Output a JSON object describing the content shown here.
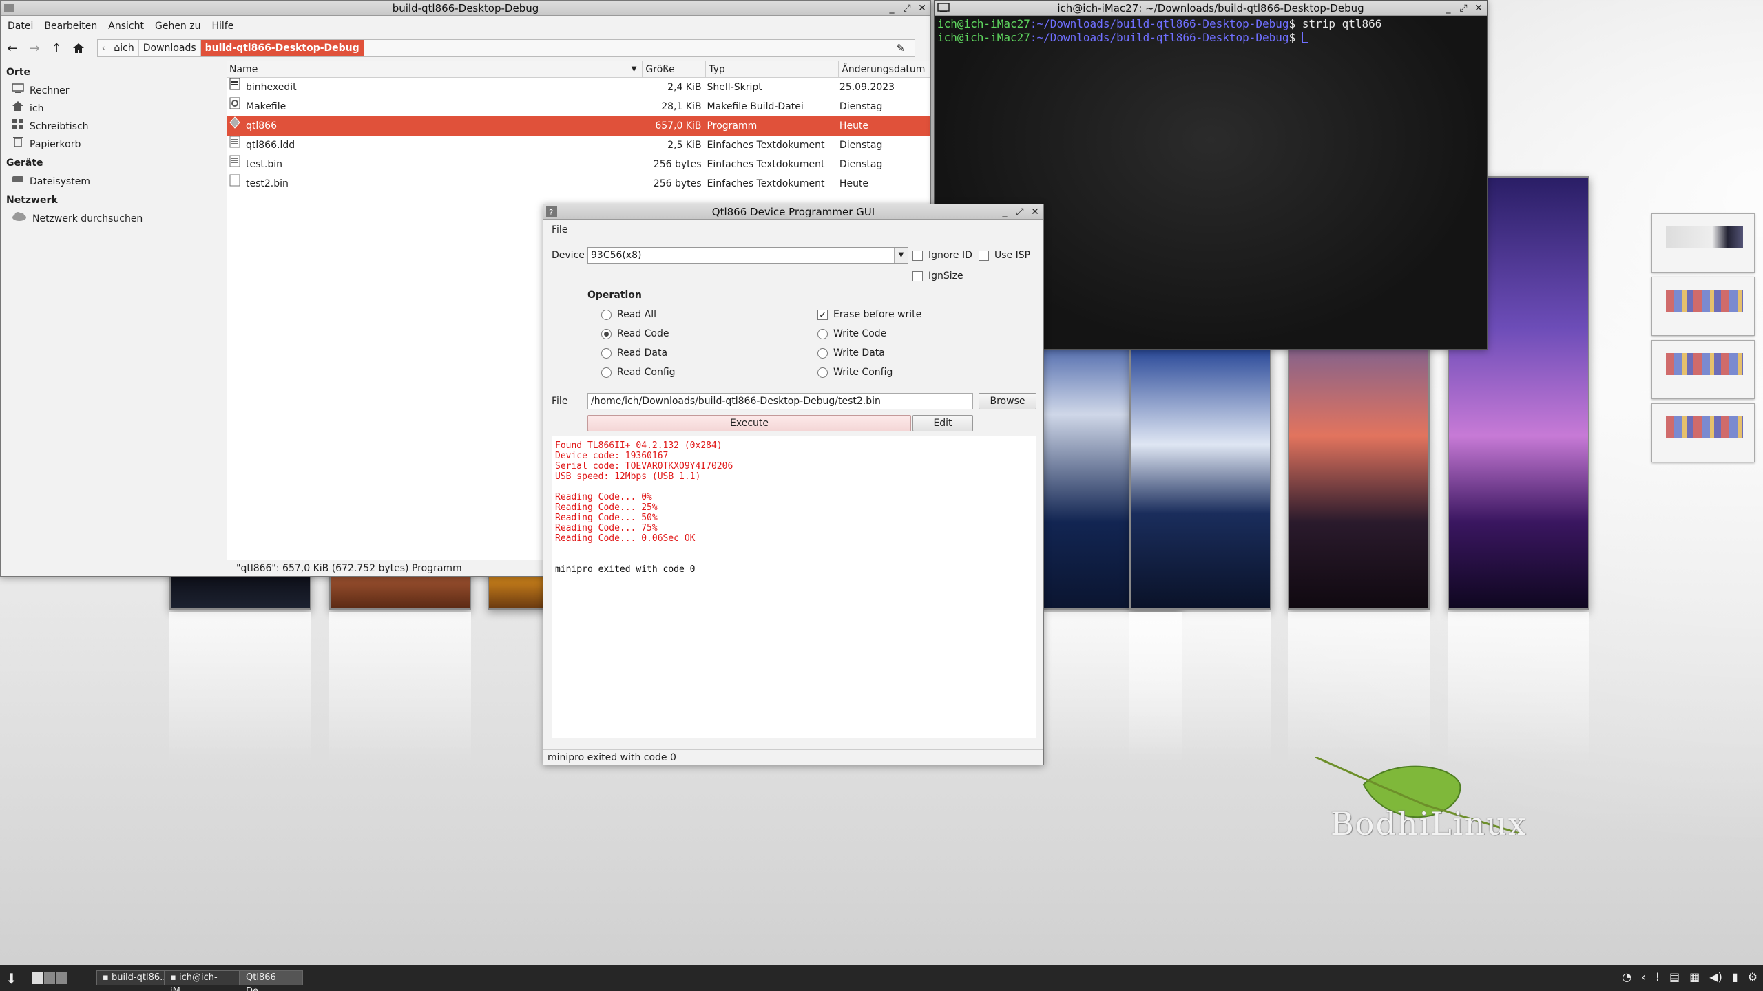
{
  "file_manager": {
    "title": "build-qtl866-Desktop-Debug",
    "menu": [
      "Datei",
      "Bearbeiten",
      "Ansicht",
      "Gehen zu",
      "Hilfe"
    ],
    "breadcrumbs": [
      "ich",
      "Downloads",
      "build-qtl866-Desktop-Debug"
    ],
    "sidebar": {
      "places_heading": "Orte",
      "places": [
        "Rechner",
        "ich",
        "Schreibtisch",
        "Papierkorb"
      ],
      "devices_heading": "Geräte",
      "devices": [
        "Dateisystem"
      ],
      "network_heading": "Netzwerk",
      "network": [
        "Netzwerk durchsuchen"
      ]
    },
    "columns": [
      "Name",
      "Größe",
      "Typ",
      "Änderungsdatum"
    ],
    "files": [
      {
        "name": "binhexedit",
        "size": "2,4 KiB",
        "type": "Shell-Skript",
        "date": "25.09.2023"
      },
      {
        "name": "Makefile",
        "size": "28,1 KiB",
        "type": "Makefile Build-Datei",
        "date": "Dienstag"
      },
      {
        "name": "qtl866",
        "size": "657,0 KiB",
        "type": "Programm",
        "date": "Heute"
      },
      {
        "name": "qtl866.ldd",
        "size": "2,5 KiB",
        "type": "Einfaches Textdokument",
        "date": "Dienstag"
      },
      {
        "name": "test.bin",
        "size": "256 bytes",
        "type": "Einfaches Textdokument",
        "date": "Dienstag"
      },
      {
        "name": "test2.bin",
        "size": "256 bytes",
        "type": "Einfaches Textdokument",
        "date": "Heute"
      }
    ],
    "status": "\"qtl866\": 657,0 KiB (672.752 bytes) Programm"
  },
  "terminal": {
    "title": "ich@ich-iMac27: ~/Downloads/build-qtl866-Desktop-Debug",
    "lines": [
      {
        "user": "ich@ich-iMac27",
        "path": ":~/Downloads/build-qtl866-Desktop-Debug",
        "prompt": "$ ",
        "cmd": "strip qtl866"
      },
      {
        "user": "ich@ich-iMac27",
        "path": ":~/Downloads/build-qtl866-Desktop-Debug",
        "prompt": "$ ",
        "cmd": ""
      }
    ]
  },
  "qtl866": {
    "title": "Qtl866 Device Programmer GUI",
    "menu_file": "File",
    "device_label": "Device",
    "device_value": "93C56(x8)",
    "ignore_id": "Ignore ID",
    "use_isp": "Use ISP",
    "ignsize": "IgnSize",
    "operation_heading": "Operation",
    "ops_left": [
      "Read All",
      "Read Code",
      "Read Data",
      "Read Config"
    ],
    "ops_right": [
      "Erase before write",
      "Write Code",
      "Write Data",
      "Write Config"
    ],
    "file_label": "File",
    "file_path": "/home/ich/Downloads/build-qtl866-Desktop-Debug/test2.bin",
    "browse": "Browse",
    "execute": "Execute",
    "edit": "Edit",
    "log_red": [
      "Found TL866II+ 04.2.132 (0x284)",
      "Device code: 19360167",
      "Serial code: TOEVAR0TKXO9Y4I70206",
      "USB speed: 12Mbps (USB 1.1)",
      "",
      "Reading Code... 0%",
      "Reading Code... 25%",
      "Reading Code... 50%",
      "Reading Code... 75%",
      "Reading Code... 0.06Sec OK"
    ],
    "log_black": "minipro exited with code 0",
    "status": "minipro exited with code 0"
  },
  "taskbar": {
    "items": [
      "build-qtl86...",
      "ich@ich-iM...",
      "Qtl866 De..."
    ]
  },
  "desktop": {
    "logo": "BodhiLinux"
  },
  "colors": {
    "accent": "#e0513a",
    "log_red": "#e01818",
    "terminal_user": "#5fd75f",
    "terminal_path": "#6f6fff"
  }
}
